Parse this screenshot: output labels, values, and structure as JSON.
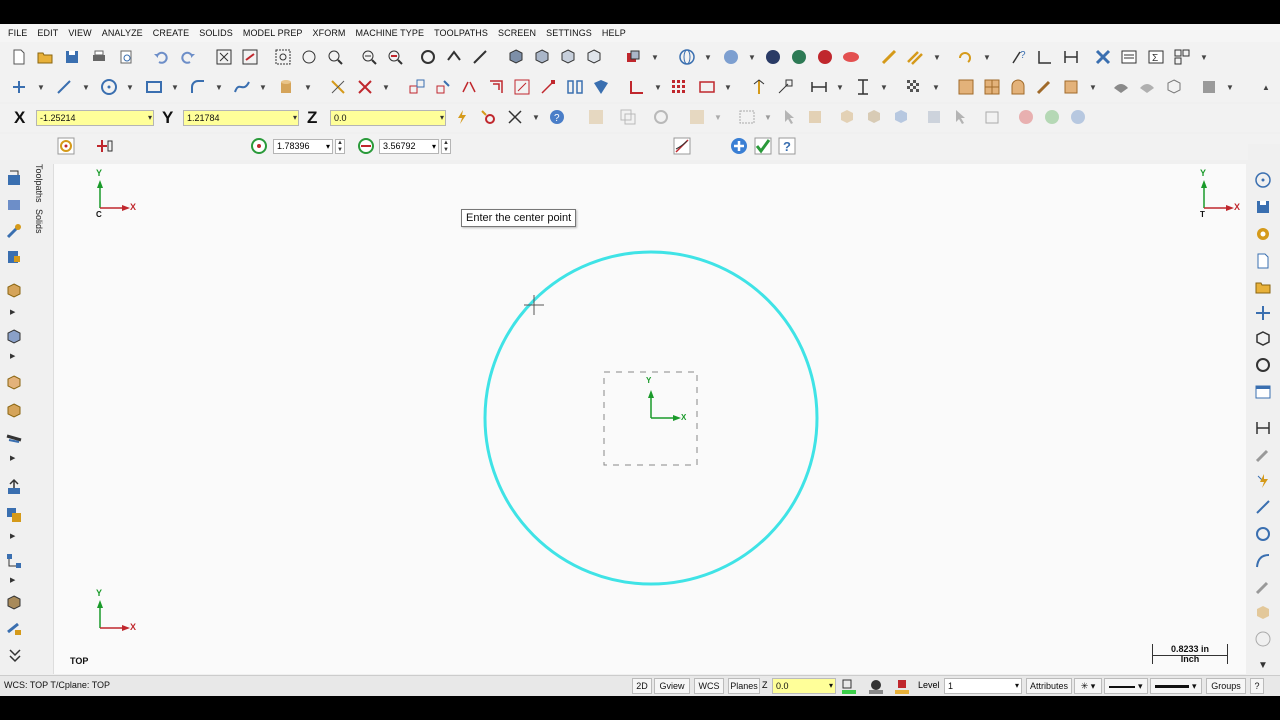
{
  "menu": [
    "FILE",
    "EDIT",
    "VIEW",
    "ANALYZE",
    "CREATE",
    "SOLIDS",
    "MODEL PREP",
    "XFORM",
    "MACHINE TYPE",
    "TOOLPATHS",
    "SCREEN",
    "SETTINGS",
    "HELP"
  ],
  "coords": {
    "x_label": "X",
    "x_value": "-1.25214",
    "y_label": "Y",
    "y_value": "1.21784",
    "z_label": "Z",
    "z_value": "0.0"
  },
  "circle_bar": {
    "radius_value": "1.78396",
    "diameter_value": "3.56792"
  },
  "side_tabs": [
    "Toolpaths",
    "Solids"
  ],
  "viewport": {
    "prompt": "Enter the center point",
    "view_name": "TOP",
    "scale_value": "0.8233 in",
    "scale_unit": "Inch",
    "axis_x": "X",
    "axis_y": "Y",
    "axis_c": "C",
    "axis_t": "T"
  },
  "status": {
    "wcs_text": "WCS: TOP  T/Cplane: TOP",
    "btn_2d": "2D",
    "btn_gview": "Gview",
    "btn_wcs": "WCS",
    "btn_planes": "Planes",
    "z_label": "Z",
    "z_value": "0.0",
    "level_label": "Level",
    "level_value": "1",
    "attributes_label": "Attributes",
    "groups_label": "Groups",
    "help_label": "?"
  },
  "colors": {
    "circle": "#3fe3e6",
    "axis_x": "#c0272d",
    "axis_y": "#1a9a2a",
    "input_bg": "#ffff99"
  }
}
